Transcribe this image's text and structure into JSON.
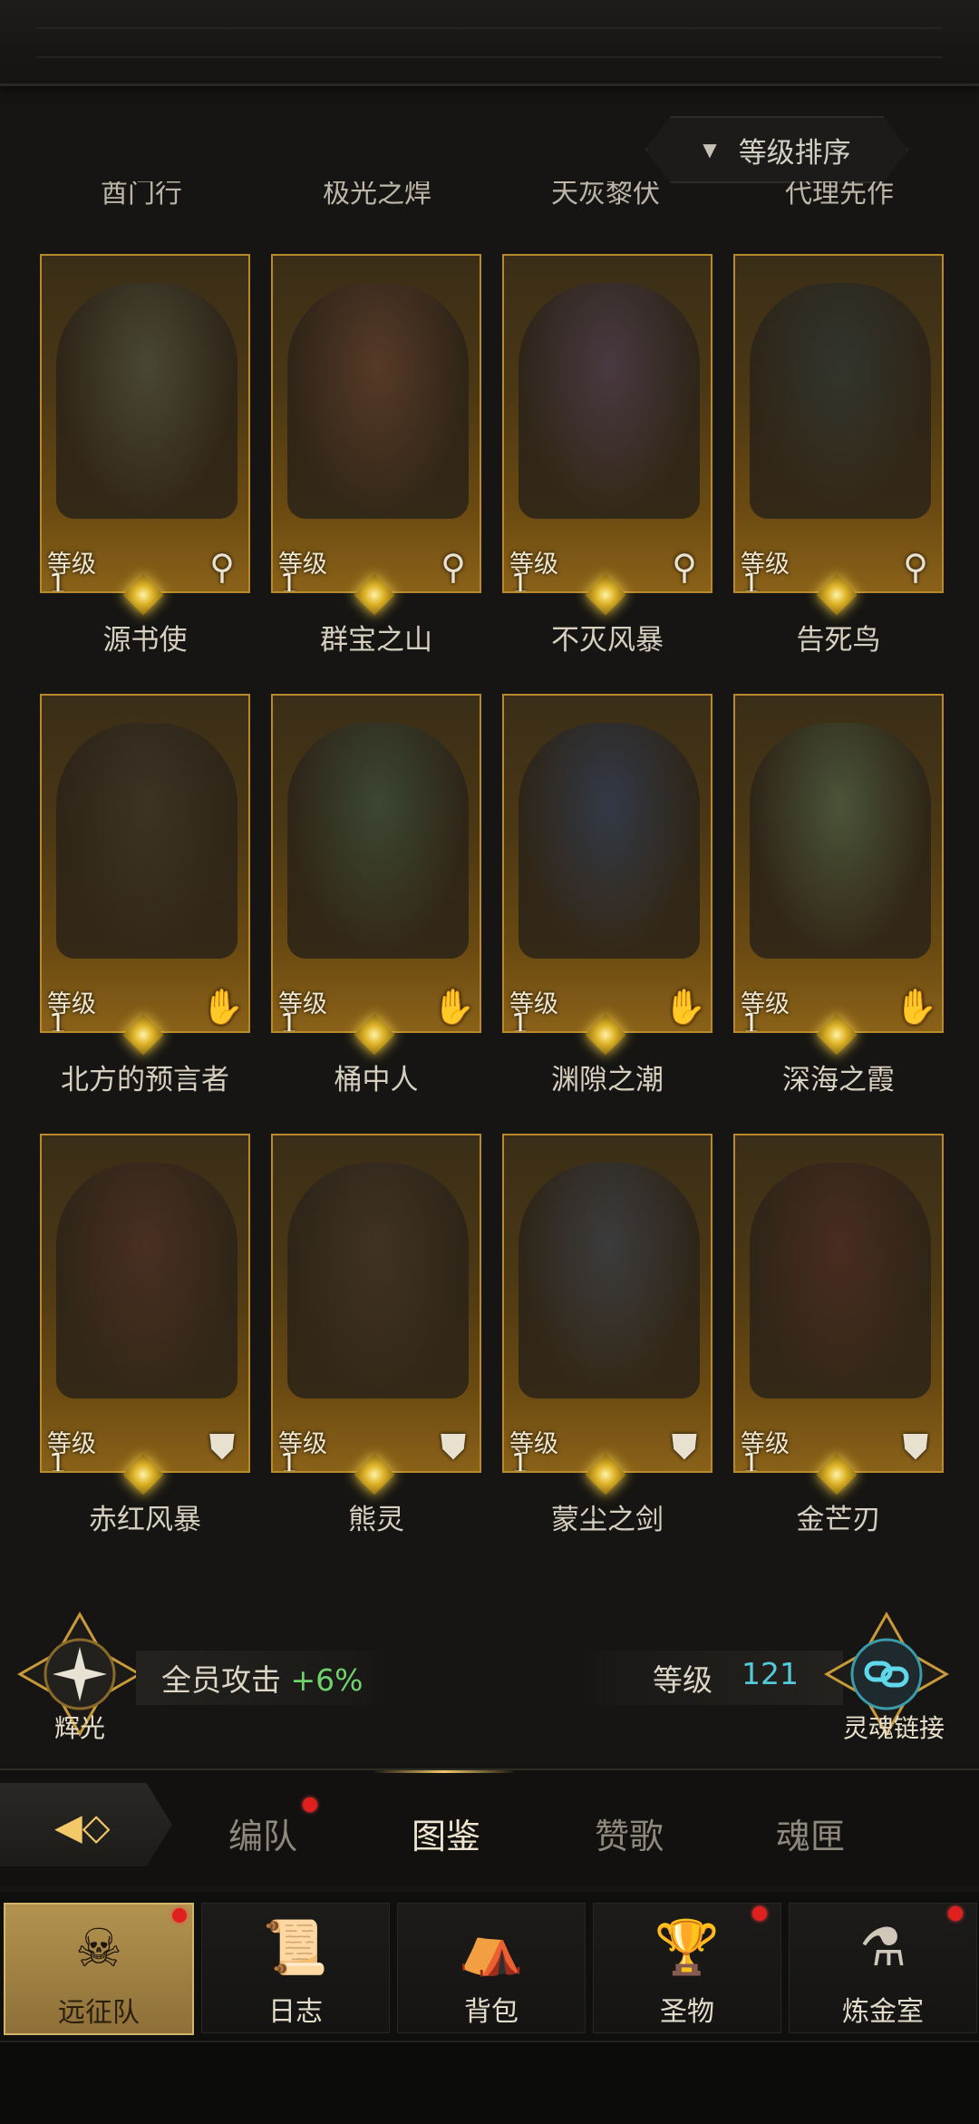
{
  "sort": {
    "label": "等级排序",
    "icon": "triangle-down-icon"
  },
  "cut_names": [
    "酋门行",
    "极光之焊",
    "天灰黎伏",
    "代理先作"
  ],
  "level_label": "等级",
  "cards": [
    {
      "name": "源书使",
      "level": "1",
      "role_icon": "key-icon",
      "color": "#4a4a3a"
    },
    {
      "name": "群宝之山",
      "level": "1",
      "role_icon": "key-icon",
      "color": "#5a3a2a"
    },
    {
      "name": "不灭风暴",
      "level": "1",
      "role_icon": "key-icon",
      "color": "#4a3a4a"
    },
    {
      "name": "告死鸟",
      "level": "1",
      "role_icon": "key-icon",
      "color": "#2e3530"
    },
    {
      "name": "北方的预言者",
      "level": "1",
      "role_icon": "hand-icon",
      "color": "#3a3328"
    },
    {
      "name": "桶中人",
      "level": "1",
      "role_icon": "hand-icon",
      "color": "#3a4a38"
    },
    {
      "name": "渊隙之潮",
      "level": "1",
      "role_icon": "hand-icon",
      "color": "#2f3a4f"
    },
    {
      "name": "深海之霞",
      "level": "1",
      "role_icon": "hand-icon",
      "color": "#4b5a3e"
    },
    {
      "name": "赤红风暴",
      "level": "1",
      "role_icon": "shield-icon",
      "color": "#4a2e24"
    },
    {
      "name": "熊灵",
      "level": "1",
      "role_icon": "shield-icon",
      "color": "#3f3226"
    },
    {
      "name": "蒙尘之剑",
      "level": "1",
      "role_icon": "shield-icon",
      "color": "#3a3d44"
    },
    {
      "name": "金芒刃",
      "level": "1",
      "role_icon": "shield-icon",
      "color": "#4a2a22"
    }
  ],
  "bonus": {
    "radiance_label": "辉光",
    "attack_label": "全员攻击",
    "attack_value": "+6%",
    "level_label": "等级",
    "level_value": "121",
    "soul_label": "灵魂链接"
  },
  "tabs": {
    "team": "编队",
    "codex": "图鉴",
    "hymn": "赞歌",
    "soul_box": "魂匣"
  },
  "nav": [
    {
      "label": "远征队",
      "icon": "horned-helmet-icon",
      "badge": true
    },
    {
      "label": "日志",
      "icon": "scroll-icon",
      "badge": false
    },
    {
      "label": "背包",
      "icon": "backpack-icon",
      "badge": false
    },
    {
      "label": "圣物",
      "icon": "chalice-icon",
      "badge": true
    },
    {
      "label": "炼金室",
      "icon": "alchemy-icon",
      "badge": true
    }
  ]
}
